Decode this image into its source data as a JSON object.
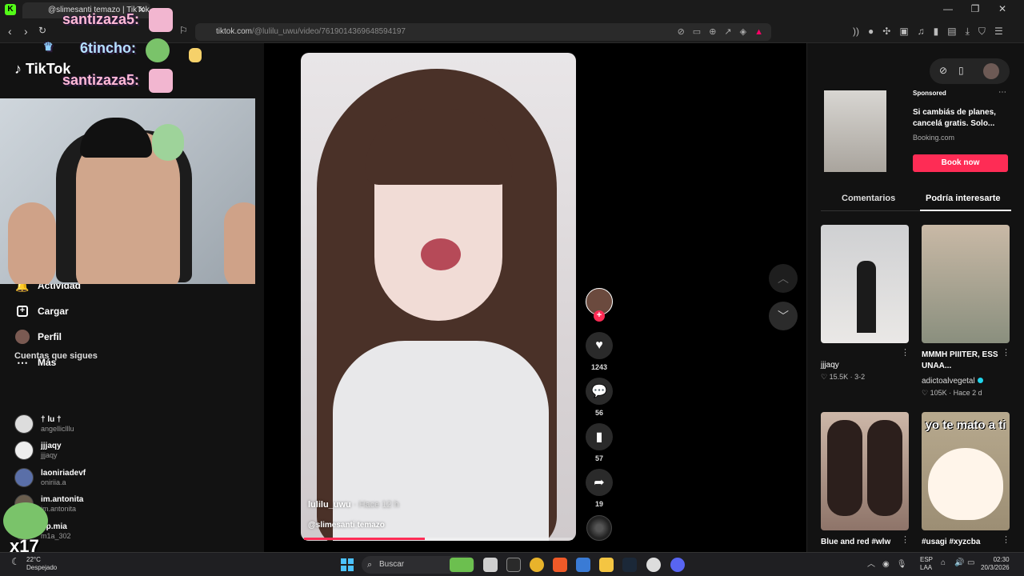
{
  "browser": {
    "tab_title": "@slimesanti temazo | TikTok",
    "url_host": "tiktok.com",
    "url_path": "/@lulilu_uwu/video/7619014369648594197"
  },
  "sidebar": {
    "logo": "TikTok",
    "menu": [
      {
        "label": "Actividad",
        "icon": "bell-icon"
      },
      {
        "label": "Cargar",
        "icon": "upload-plus-icon"
      },
      {
        "label": "Perfil",
        "icon": "avatar-icon"
      },
      {
        "label": "Más",
        "icon": "more-icon"
      }
    ],
    "following_title": "Cuentas que sigues",
    "following": [
      {
        "name": "† lu †",
        "handle": "angelliclllu"
      },
      {
        "name": "jjjaqy",
        "handle": "jjjaqy"
      },
      {
        "name": "laoniriadevf",
        "handle": "oniriia.a"
      },
      {
        "name": "im.antonita",
        "handle": "im.antonita"
      },
      {
        "name": "rip.mia",
        "handle": "m1a_302"
      }
    ]
  },
  "overlay": {
    "chat1": "santizaza5:",
    "chat2": "6tincho:",
    "chat3": "santizaza5:",
    "badge": "x17"
  },
  "video": {
    "author": "lulilu_uwu",
    "time": "· Hace 12 h",
    "description": "@slimesanti temazo",
    "progress": 0.45
  },
  "actions": {
    "likes": "1243",
    "comments": "56",
    "saves": "57",
    "shares": "19"
  },
  "ad": {
    "sponsored": "Sponsored",
    "title": "Si cambiás de planes, cancelá gratis. Solo...",
    "domain": "Booking.com",
    "button": "Book now"
  },
  "tabs": {
    "comments": "Comentarios",
    "recommended": "Podría interesarte"
  },
  "recommended": [
    {
      "title": "jjjaqy",
      "stats": "♡ 15.5K · 3-2"
    },
    {
      "title": "MMMH PIIITER, ESS UNAA...",
      "author": "adictoalvegetal",
      "stats": "♡ 105K · Hace 2 d"
    },
    {
      "title": "Blue and red #wlw"
    },
    {
      "title": "#usagi #xyzcba",
      "overlay": "yo te mato a ti"
    }
  ],
  "taskbar": {
    "temp": "22°C",
    "weather": "Despejado",
    "search": "Buscar",
    "lang1": "ESP",
    "lang2": "LAA",
    "time": "02:30",
    "date": "20/3/2026"
  }
}
